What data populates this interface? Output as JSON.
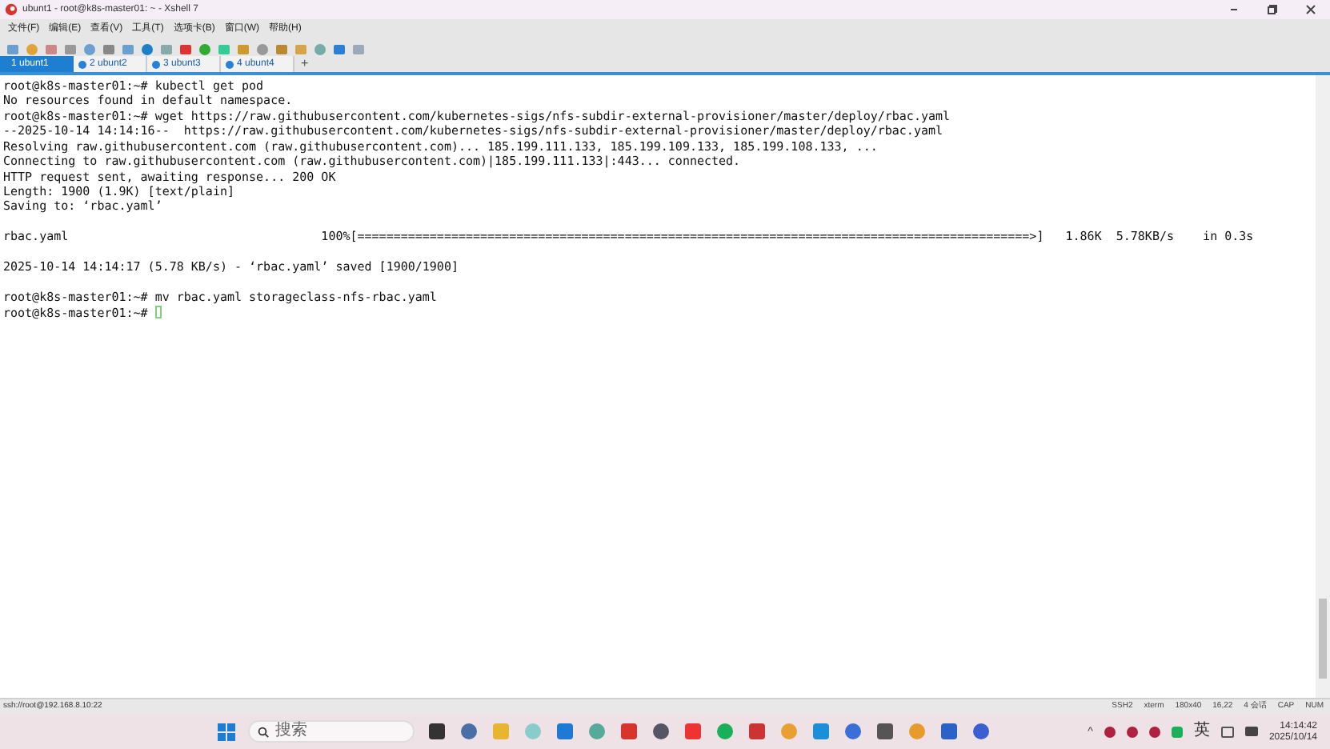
{
  "window": {
    "title": "ubunt1 - root@k8s-master01: ~ - Xshell 7"
  },
  "menu": [
    "文件(F)",
    "编辑(E)",
    "查看(V)",
    "工具(T)",
    "选项卡(B)",
    "窗口(W)",
    "帮助(H)"
  ],
  "tabs": [
    {
      "label": "1 ubunt1",
      "selected": true
    },
    {
      "label": "2 ubunt2",
      "selected": false
    },
    {
      "label": "3 ubunt3",
      "selected": false
    },
    {
      "label": "4 ubunt4",
      "selected": false
    }
  ],
  "new_tab": "+",
  "terminal": {
    "lines": [
      {
        "kind": "text",
        "text": "root@k8s-master01:~# kubectl get pod"
      },
      {
        "kind": "text",
        "text": "No resources found in default namespace."
      },
      {
        "kind": "text",
        "text": "root@k8s-master01:~# wget https://raw.githubusercontent.com/kubernetes-sigs/nfs-subdir-external-provisioner/master/deploy/rbac.yaml"
      },
      {
        "kind": "text",
        "text": "--2025-10-14 14:14:16--  https://raw.githubusercontent.com/kubernetes-sigs/nfs-subdir-external-provisioner/master/deploy/rbac.yaml"
      },
      {
        "kind": "text",
        "text": "Resolving raw.githubusercontent.com (raw.githubusercontent.com)... 185.199.111.133, 185.199.109.133, 185.199.108.133, ..."
      },
      {
        "kind": "text",
        "text": "Connecting to raw.githubusercontent.com (raw.githubusercontent.com)|185.199.111.133|:443... connected."
      },
      {
        "kind": "text",
        "text": "HTTP request sent, awaiting response... 200 OK"
      },
      {
        "kind": "text",
        "text": "Length: 1900 (1.9K) [text/plain]"
      },
      {
        "kind": "text",
        "text": "Saving to: ‘rbac.yaml’"
      },
      {
        "kind": "blank"
      },
      {
        "kind": "text",
        "text": "rbac.yaml                                   100%[=============================================================================================>]   1.86K  5.78KB/s    in 0.3s"
      },
      {
        "kind": "blank"
      },
      {
        "kind": "text",
        "text": "2025-10-14 14:14:17 (5.78 KB/s) - ‘rbac.yaml’ saved [1900/1900]"
      },
      {
        "kind": "blank"
      },
      {
        "kind": "text",
        "text": "root@k8s-master01:~# mv rbac.yaml storageclass-nfs-rbac.yaml"
      },
      {
        "kind": "prompt",
        "text": "root@k8s-master01:~#",
        "cursor": true
      }
    ]
  },
  "status_bar": {
    "address": "ssh://root@192.168.8.10:22",
    "items": [
      "SSH2",
      "xterm",
      "180x40",
      "16,22",
      "4 会话",
      "CAP",
      "NUM"
    ]
  },
  "taskbar": {
    "search_placeholder": "搜索",
    "tray_expand": "^",
    "input_method": "英",
    "time": "14:14:42",
    "date": "2025/10/14"
  }
}
